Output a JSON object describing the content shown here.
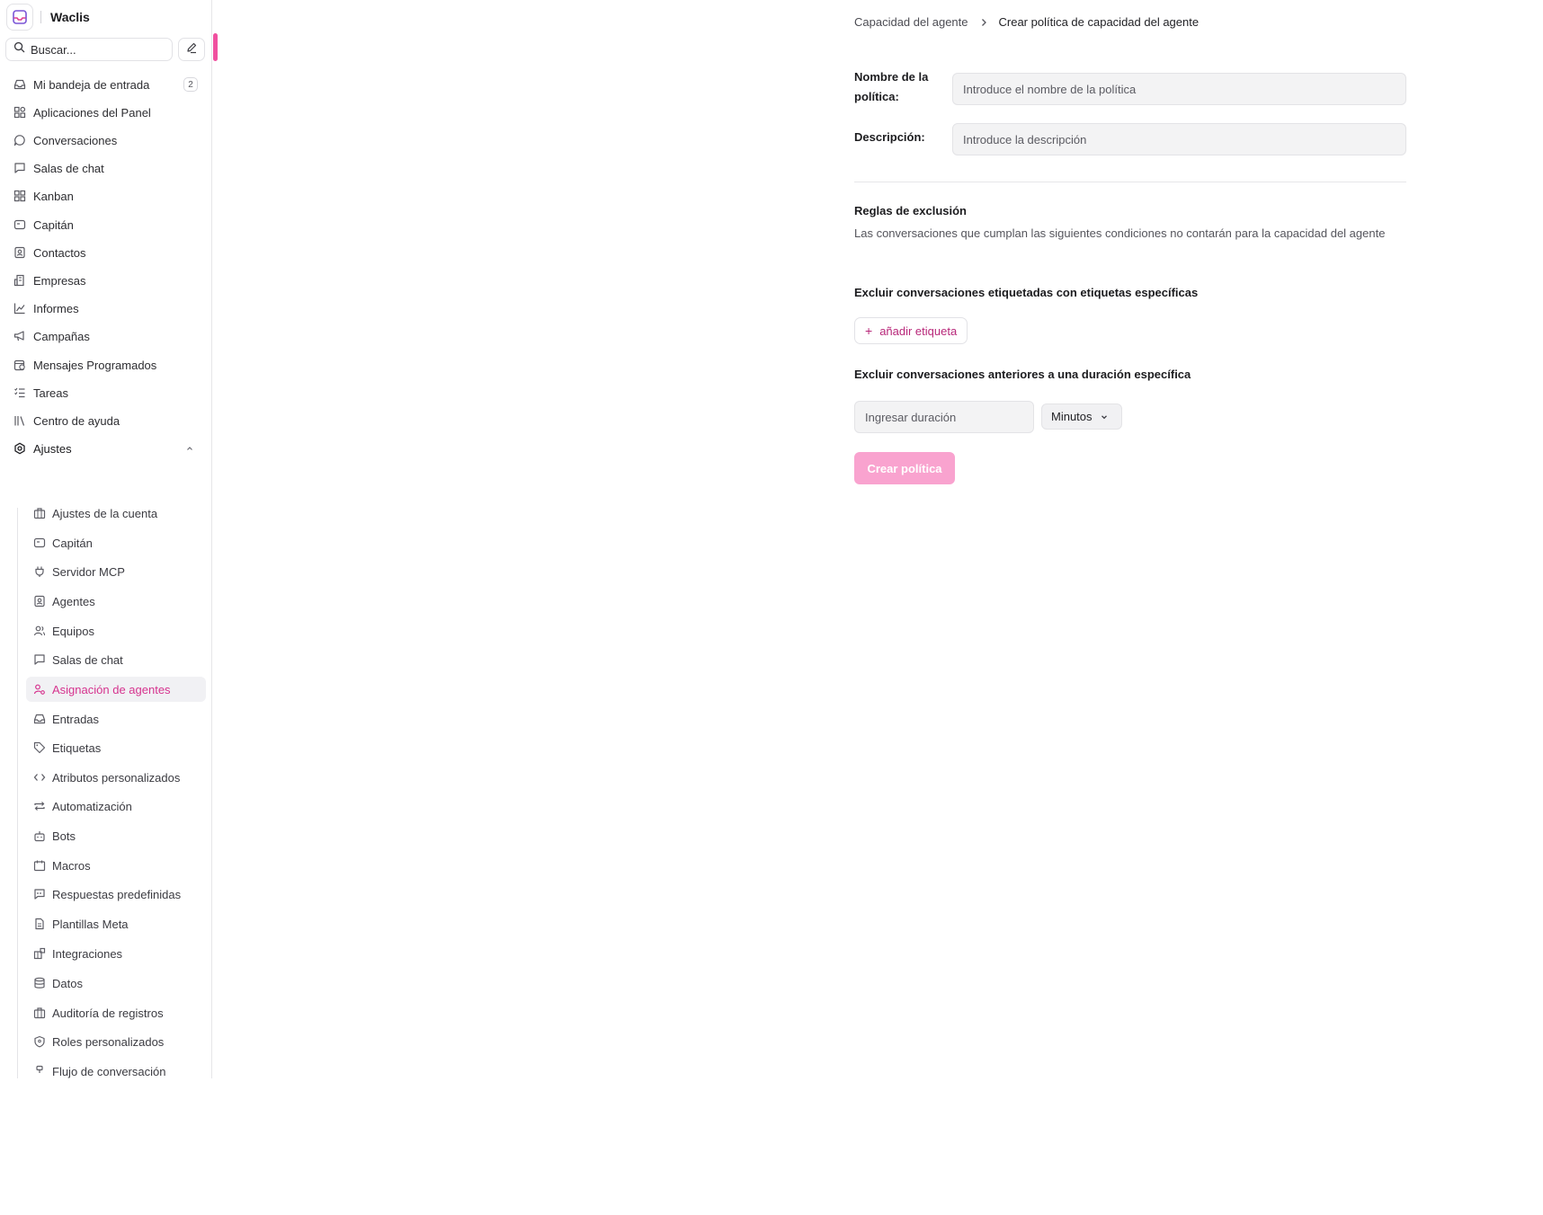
{
  "colors": {
    "accent": "#d6338e",
    "primary_button_disabled": "#f9a3cf",
    "scroll_thumb": "#f0509f"
  },
  "app": {
    "name": "Waclis",
    "logo_icon": "inbox-logo-icon"
  },
  "search": {
    "placeholder": "Buscar..."
  },
  "sidebar": {
    "items": [
      {
        "label": "Mi bandeja de entrada",
        "icon": "inbox-icon",
        "badge": "2"
      },
      {
        "label": "Aplicaciones del Panel",
        "icon": "apps-grid-icon"
      },
      {
        "label": "Conversaciones",
        "icon": "chat-bubble-icon"
      },
      {
        "label": "Salas de chat",
        "icon": "message-square-icon"
      },
      {
        "label": "Kanban",
        "icon": "kanban-icon"
      },
      {
        "label": "Capitán",
        "icon": "captain-icon"
      },
      {
        "label": "Contactos",
        "icon": "contacts-icon"
      },
      {
        "label": "Empresas",
        "icon": "building-icon"
      },
      {
        "label": "Informes",
        "icon": "chart-line-icon"
      },
      {
        "label": "Campañas",
        "icon": "megaphone-icon"
      },
      {
        "label": "Mensajes Programados",
        "icon": "calendar-clock-icon"
      },
      {
        "label": "Tareas",
        "icon": "task-list-icon"
      },
      {
        "label": "Centro de ayuda",
        "icon": "library-icon"
      },
      {
        "label": "Ajustes",
        "icon": "settings-icon",
        "expanded": true
      }
    ],
    "settings_items": [
      {
        "label": "Ajustes de la cuenta",
        "icon": "briefcase-icon"
      },
      {
        "label": "Capitán",
        "icon": "captain-icon"
      },
      {
        "label": "Servidor MCP",
        "icon": "plug-icon"
      },
      {
        "label": "Agentes",
        "icon": "agent-icon"
      },
      {
        "label": "Equipos",
        "icon": "users-icon"
      },
      {
        "label": "Salas de chat",
        "icon": "message-square-icon"
      },
      {
        "label": "Asignación de agentes",
        "icon": "user-assign-icon",
        "active": true
      },
      {
        "label": "Entradas",
        "icon": "inbox-icon"
      },
      {
        "label": "Etiquetas",
        "icon": "tag-icon"
      },
      {
        "label": "Atributos personalizados",
        "icon": "code-icon"
      },
      {
        "label": "Automatización",
        "icon": "repeat-icon"
      },
      {
        "label": "Bots",
        "icon": "bot-icon"
      },
      {
        "label": "Macros",
        "icon": "macros-icon"
      },
      {
        "label": "Respuestas predefinidas",
        "icon": "quote-message-icon"
      },
      {
        "label": "Plantillas Meta",
        "icon": "document-icon"
      },
      {
        "label": "Integraciones",
        "icon": "puzzle-icon"
      },
      {
        "label": "Datos",
        "icon": "database-icon"
      },
      {
        "label": "Auditoría de registros",
        "icon": "briefcase-icon"
      },
      {
        "label": "Roles personalizados",
        "icon": "shield-icon"
      },
      {
        "label": "Flujo de conversación",
        "icon": "flow-icon"
      }
    ]
  },
  "breadcrumb": {
    "parent": "Capacidad del agente",
    "current": "Crear política de capacidad del agente"
  },
  "form": {
    "name_label_line1": "Nombre de la",
    "name_label_line2": "política:",
    "name_placeholder": "Introduce el nombre de la política",
    "name_value": "",
    "description_label": "Descripción:",
    "description_placeholder": "Introduce la descripción",
    "description_value": ""
  },
  "exclusion": {
    "title": "Reglas de exclusión",
    "description": "Las conversaciones que cumplan las siguientes condiciones no contarán para la capacidad del agente",
    "labels_title": "Excluir conversaciones etiquetadas con etiquetas específicas",
    "add_label_button": "añadir etiqueta",
    "duration_title": "Excluir conversaciones anteriores a una duración específica",
    "duration_placeholder": "Ingresar duración",
    "duration_value": "",
    "unit_selected": "Minutos"
  },
  "actions": {
    "create_button": "Crear política",
    "create_disabled": true
  }
}
